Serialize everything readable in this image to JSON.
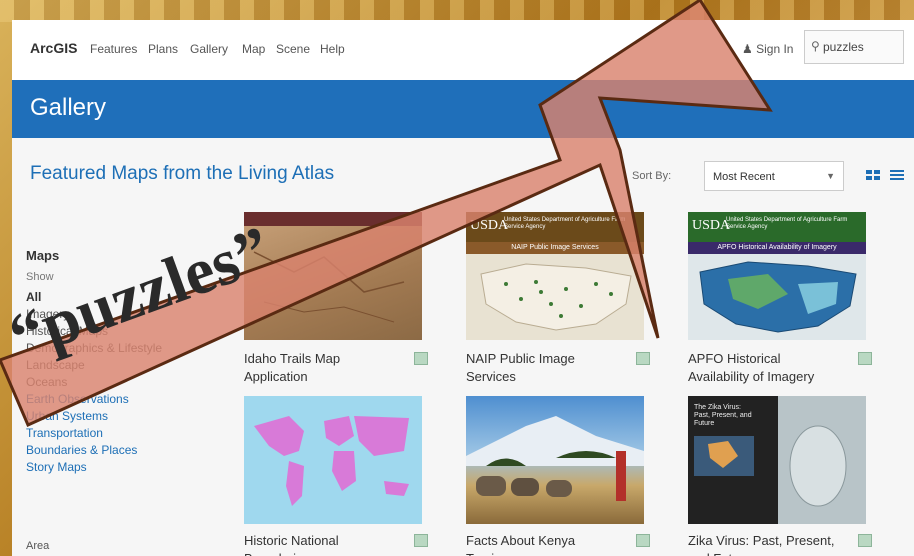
{
  "nav": {
    "logo": "ArcGIS",
    "links": [
      "Features",
      "Plans",
      "Gallery",
      "Map",
      "Scene",
      "Help"
    ],
    "sign_in": "Sign In",
    "search_value": "puzzles"
  },
  "banner": {
    "title": "Gallery"
  },
  "section": {
    "title": "Featured Maps from the Living Atlas",
    "sort_label": "Sort By:",
    "sort_value": "Most Recent"
  },
  "sidebar": {
    "heading": "Maps",
    "show_label": "Show",
    "items": [
      "All",
      "Imagery",
      "Historical Maps",
      "Demographics & Lifestyle",
      "Landscape",
      "Oceans",
      "Earth Observations",
      "Urban Systems",
      "Transportation",
      "Boundaries & Places",
      "Story Maps"
    ],
    "area_label": "Area"
  },
  "cards": [
    {
      "title": "Idaho Trails Map Application"
    },
    {
      "title": "NAIP Public Image Services",
      "banner": "United States Department of Agriculture Farm Service Agency",
      "strip": "NAIP Public Image Services",
      "logo": "USDA"
    },
    {
      "title": "APFO Historical Availability of Imagery",
      "banner": "United States Department of Agriculture Farm Service Agency",
      "strip": "APFO Historical Availability of Imagery",
      "logo": "USDA"
    },
    {
      "title": "Historic National Boundaries"
    },
    {
      "title": "Facts About Kenya Tourism"
    },
    {
      "title": "Zika Virus: Past, Present, and Future",
      "thumb_text": "The Zika Virus: Past, Present, and Future"
    }
  ],
  "annotation": {
    "text": "“puzzles”"
  },
  "colors": {
    "banner": "#1f6fba",
    "link": "#1d6fb6",
    "arrow_fill": "#d9826e",
    "arrow_stroke": "#5a2a12"
  }
}
